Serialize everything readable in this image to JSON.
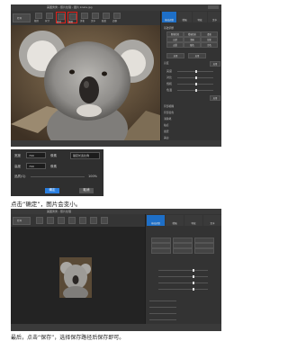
{
  "screenshot1": {
    "window_title": "美图秀秀 - 照片处理 - 图片 koala.jpg",
    "top_button": "打开",
    "tools": [
      "裁剪",
      "尺寸",
      "旋转",
      "抠图",
      "美化",
      "文字",
      "贴纸",
      "边框"
    ],
    "panel_tabs": [
      "基础调整",
      "增强",
      "特效",
      "文字"
    ],
    "panel_sections": [
      "基础调整",
      "亮度",
      "曝光",
      "高光",
      "锐化",
      "局部调整"
    ],
    "preset_buttons": [
      "智能优化",
      "增强色彩",
      "柔和",
      "自然",
      "清晰",
      "锐化",
      "去雾",
      "暖色",
      "冷色"
    ],
    "slider_labels": [
      "亮度",
      "对比",
      "饱和",
      "色温",
      "锐化"
    ],
    "apply_label": "应用",
    "list_items": [
      "局部模糊",
      "局部变色",
      "消除笔",
      "祛痘",
      "磨皮",
      "美白"
    ]
  },
  "dialog": {
    "width_label": "宽度",
    "width_value": "700",
    "height_label": "高度",
    "height_value": "700",
    "unit_label1": "像素",
    "unit_label2": "像素",
    "lock_label": "锁定长宽比例",
    "quality_label": "品质(Q)",
    "quality_value": "100%",
    "ok_label": "确定",
    "cancel_label": "取消"
  },
  "caption1": "点击“确定”，图片会变小。",
  "screenshot2": {
    "window_title": "美图秀秀 - 照片处理",
    "top_button": "打开",
    "panel_tabs": [
      "基础调整",
      "增强",
      "特效",
      "文字"
    ]
  },
  "caption2": "最后，点击“保存”，选择保存路径后保存即可。",
  "colors": {
    "accent_blue": "#1e6fc7",
    "highlight_red": "#e0201a",
    "app_bg": "#2c2c2c"
  }
}
